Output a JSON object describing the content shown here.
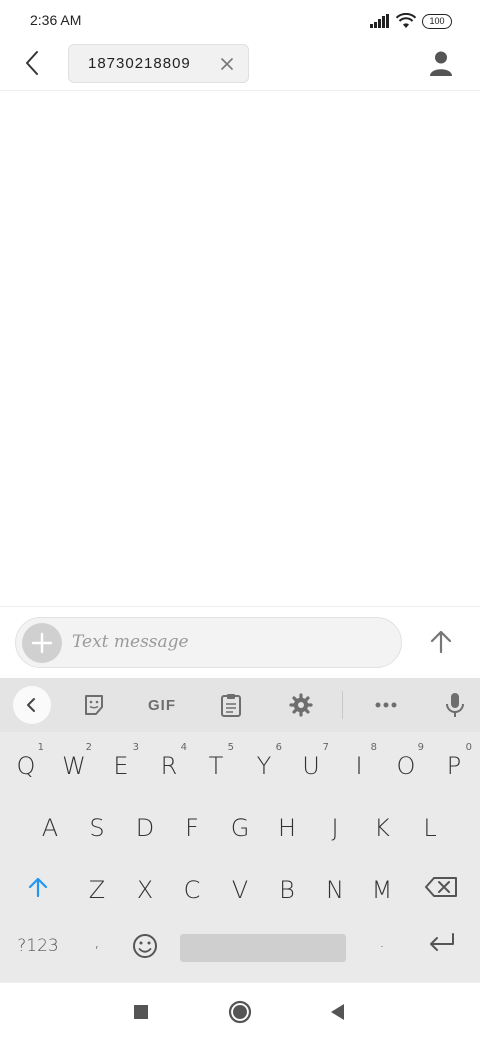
{
  "status_bar": {
    "time": "2:36 AM",
    "battery": "100"
  },
  "app_bar": {
    "recipient": "18730218809"
  },
  "compose": {
    "placeholder": "Text message"
  },
  "keyboard": {
    "toolbar": {
      "gif_label": "GIF"
    },
    "row1": [
      {
        "char": "Q",
        "hint": "1"
      },
      {
        "char": "W",
        "hint": "2"
      },
      {
        "char": "E",
        "hint": "3"
      },
      {
        "char": "R",
        "hint": "4"
      },
      {
        "char": "T",
        "hint": "5"
      },
      {
        "char": "Y",
        "hint": "6"
      },
      {
        "char": "U",
        "hint": "7"
      },
      {
        "char": "I",
        "hint": "8"
      },
      {
        "char": "O",
        "hint": "9"
      },
      {
        "char": "P",
        "hint": "0"
      }
    ],
    "row2": [
      "A",
      "S",
      "D",
      "F",
      "G",
      "H",
      "J",
      "K",
      "L"
    ],
    "row3": [
      "Z",
      "X",
      "C",
      "V",
      "B",
      "N",
      "M"
    ],
    "row4": {
      "symbols_label": "?123",
      "comma": ",",
      "period": "."
    }
  }
}
